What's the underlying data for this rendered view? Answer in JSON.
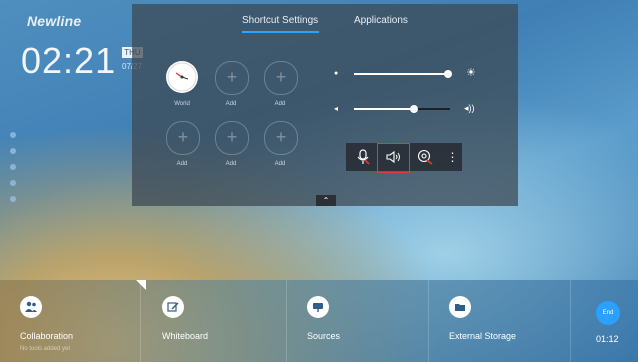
{
  "brand": "Newline",
  "clock": {
    "time": "02:21",
    "day": "THU",
    "date": "07/27"
  },
  "panel": {
    "tabs": [
      "Shortcut Settings",
      "Applications"
    ],
    "active_tab": 0,
    "shortcuts": [
      "World",
      "Add",
      "Add",
      "Add",
      "Add",
      "Add"
    ],
    "brightness_level": 0.9,
    "volume_level": 0.63,
    "icons": [
      "microphone-muted-icon",
      "speaker-icon",
      "camera-off-icon",
      "more-vertical-icon"
    ],
    "highlight": "speaker-icon",
    "collapse_glyph": "⌃"
  },
  "dock": {
    "items": [
      {
        "label": "Collaboration",
        "sub": "No tools added yet",
        "icon": "collaboration-icon"
      },
      {
        "label": "Whiteboard",
        "sub": "",
        "icon": "whiteboard-icon"
      },
      {
        "label": "Sources",
        "sub": "",
        "icon": "sources-icon"
      },
      {
        "label": "External Storage",
        "sub": "",
        "icon": "storage-icon"
      }
    ],
    "end_label": "End",
    "timer": "01:12"
  }
}
